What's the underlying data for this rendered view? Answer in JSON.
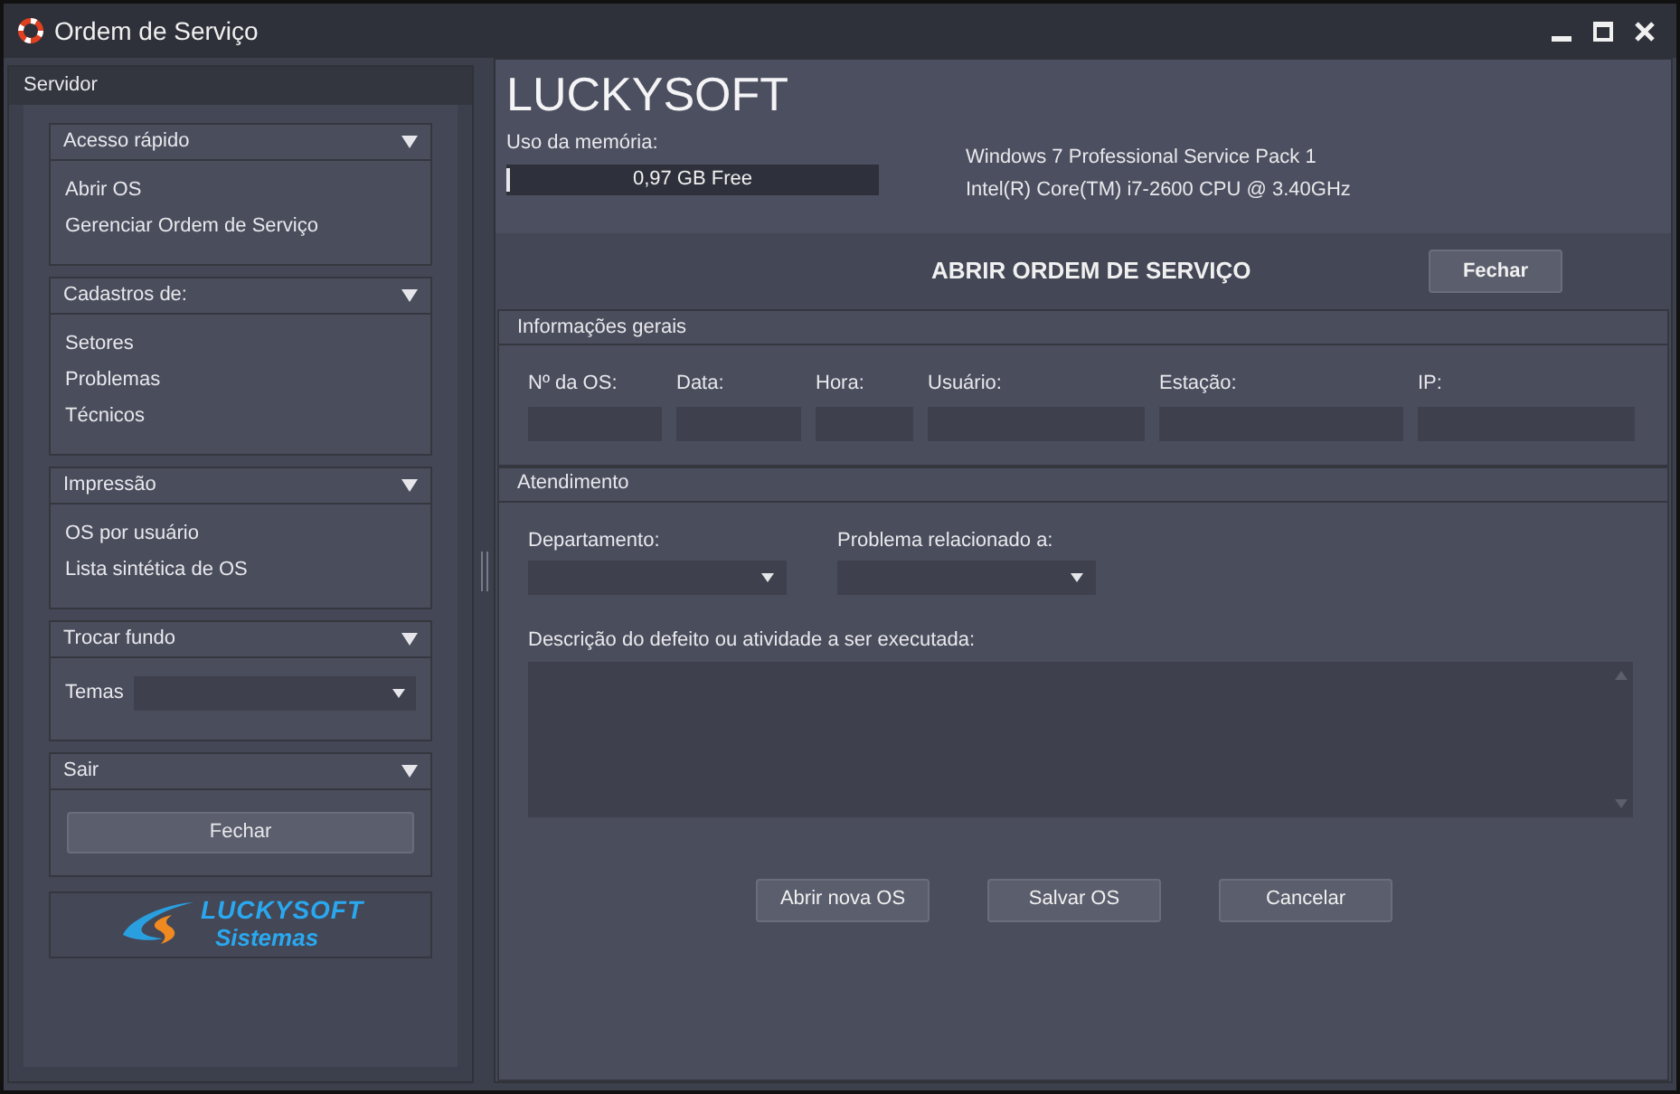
{
  "window": {
    "title": "Ordem de Serviço"
  },
  "sidebar": {
    "title": "Servidor",
    "sections": [
      {
        "kind": "links",
        "title": "Acesso rápido",
        "items": [
          "Abrir OS",
          "Gerenciar Ordem de Serviço"
        ]
      },
      {
        "kind": "links",
        "title": "Cadastros de:",
        "items": [
          "Setores",
          "Problemas",
          "Técnicos"
        ]
      },
      {
        "kind": "links",
        "title": "Impressão",
        "items": [
          "OS por usuário",
          "Lista sintética de OS"
        ]
      },
      {
        "kind": "select",
        "title": "Trocar fundo",
        "label": "Temas"
      },
      {
        "kind": "button",
        "title": "Sair",
        "button": "Fechar"
      }
    ],
    "logo": {
      "line1": "LUCKYSOFT",
      "line2": "Sistemas"
    }
  },
  "header": {
    "brand": "LUCKYSOFT",
    "memory_label": "Uso da memória:",
    "memory": {
      "level": 0.01,
      "reading": "0,97 GB Free"
    },
    "system_info": [
      "Windows 7 Professional Service Pack 1",
      "Intel(R) Core(TM) i7-2600 CPU @ 3.40GHz"
    ]
  },
  "form": {
    "title": "ABRIR ORDEM DE SERVIÇO",
    "close_button": "Fechar",
    "general": {
      "title": "Informações gerais",
      "fields": [
        "Nº da OS:",
        "Data:",
        "Hora:",
        "Usuário:",
        "Estação:",
        "IP:"
      ]
    },
    "service": {
      "title": "Atendimento",
      "selects": [
        "Departamento:",
        "Problema relacionado a:"
      ],
      "description_label": "Descrição do defeito ou atividade a ser executada:"
    },
    "buttons": [
      "Abrir nova OS",
      "Salvar OS",
      "Cancelar"
    ]
  }
}
